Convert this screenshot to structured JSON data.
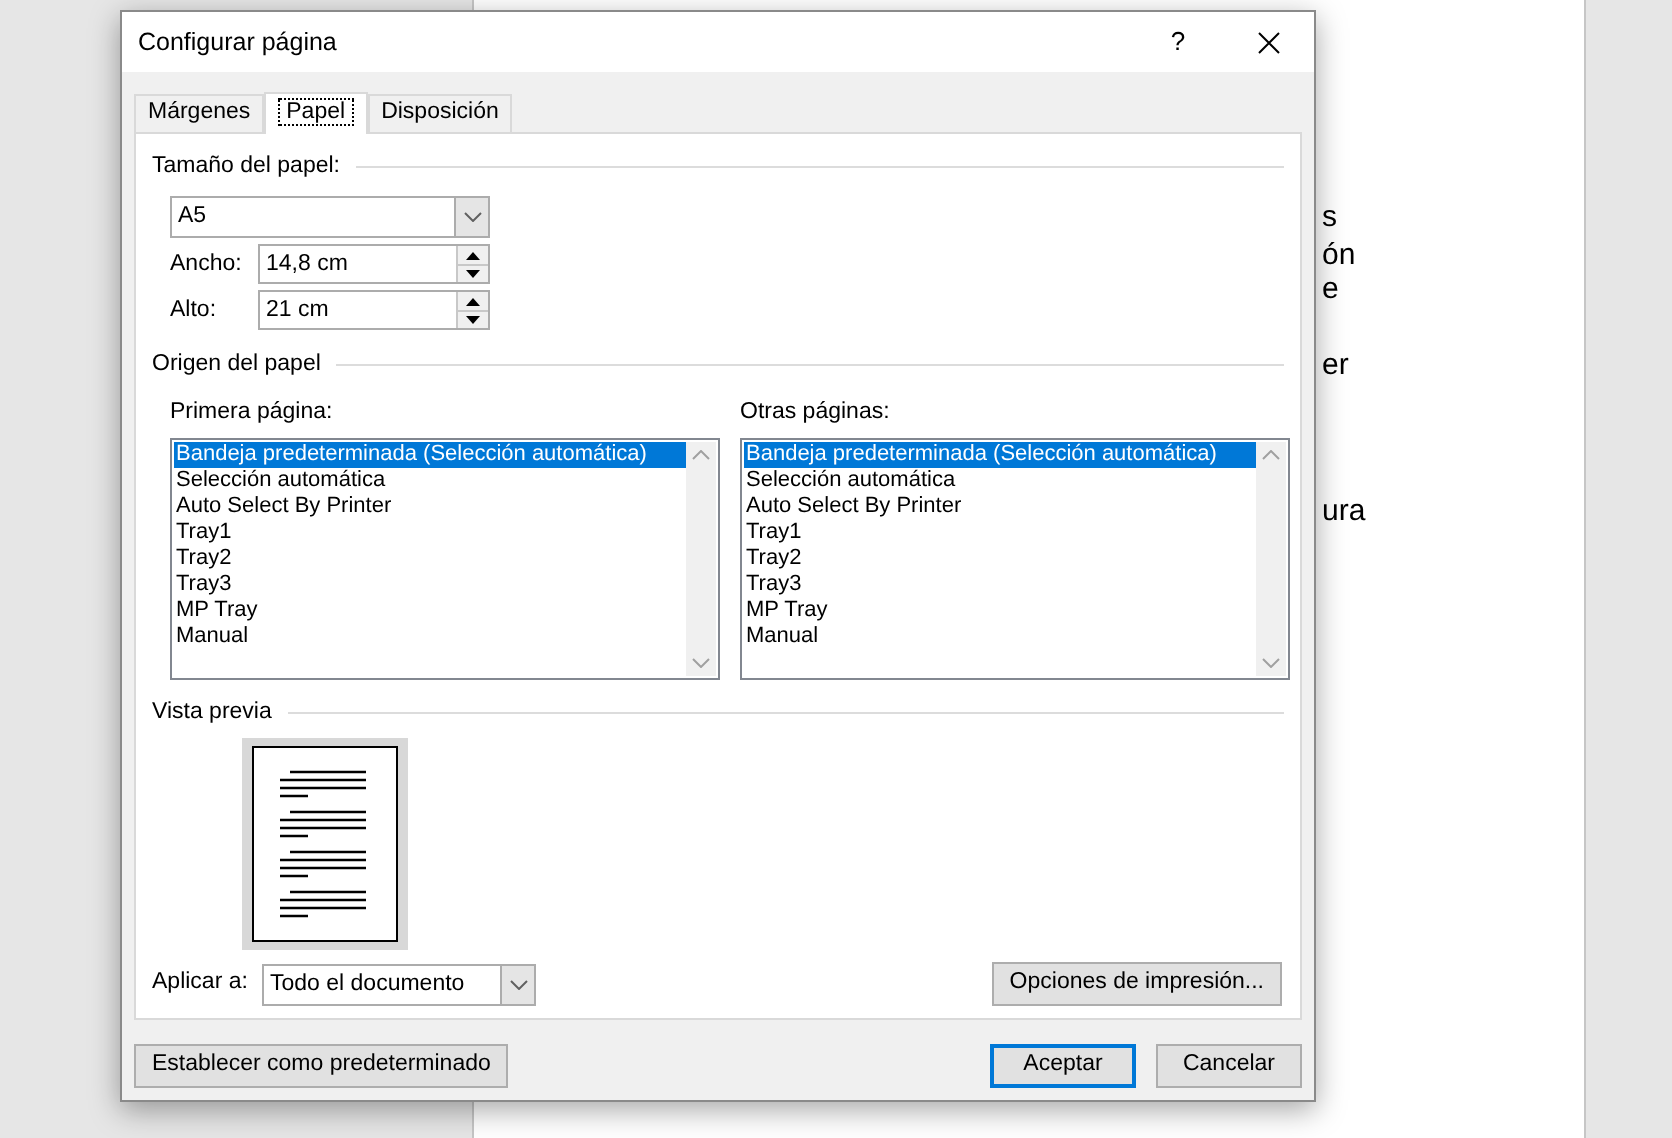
{
  "document": {
    "fragments": [
      "s",
      "ón",
      "e",
      "er",
      "ura"
    ]
  },
  "dialog": {
    "title": "Configurar página",
    "help": "?",
    "tabs": [
      {
        "label": "Márgenes",
        "selected": false
      },
      {
        "label": "Papel",
        "selected": true
      },
      {
        "label": "Disposición",
        "selected": false
      }
    ],
    "paper_size": {
      "heading": "Tamaño del papel:",
      "value": "A5",
      "width": {
        "label": "Ancho:",
        "value": "14,8 cm"
      },
      "height": {
        "label": "Alto:",
        "value": "21 cm"
      }
    },
    "paper_source": {
      "heading": "Origen del papel",
      "lists": [
        {
          "label": "Primera página:",
          "items": [
            {
              "label": "Bandeja predeterminada (Selección automática)",
              "selected": true
            },
            {
              "label": "Selección automática",
              "selected": false
            },
            {
              "label": "Auto Select By Printer",
              "selected": false
            },
            {
              "label": "Tray1",
              "selected": false
            },
            {
              "label": "Tray2",
              "selected": false
            },
            {
              "label": "Tray3",
              "selected": false
            },
            {
              "label": "MP Tray",
              "selected": false
            },
            {
              "label": "Manual",
              "selected": false
            }
          ]
        },
        {
          "label": "Otras páginas:",
          "items": [
            {
              "label": "Bandeja predeterminada (Selección automática)",
              "selected": true
            },
            {
              "label": "Selección automática",
              "selected": false
            },
            {
              "label": "Auto Select By Printer",
              "selected": false
            },
            {
              "label": "Tray1",
              "selected": false
            },
            {
              "label": "Tray2",
              "selected": false
            },
            {
              "label": "Tray3",
              "selected": false
            },
            {
              "label": "MP Tray",
              "selected": false
            },
            {
              "label": "Manual",
              "selected": false
            }
          ]
        }
      ]
    },
    "preview": {
      "heading": "Vista previa"
    },
    "apply_to": {
      "label": "Aplicar a:",
      "value": "Todo el documento"
    },
    "print_options_button": "Opciones de impresión...",
    "buttons": [
      {
        "label": "Establecer como predeterminado",
        "kind": "secondary"
      },
      {
        "label": "Aceptar",
        "kind": "default"
      },
      {
        "label": "Cancelar",
        "kind": "secondary"
      }
    ]
  }
}
